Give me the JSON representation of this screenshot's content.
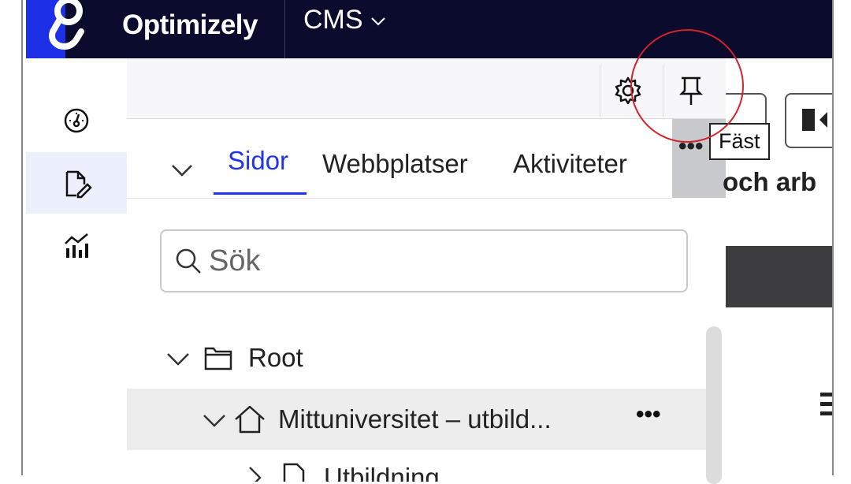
{
  "header": {
    "brand": "Optimizely",
    "product": "CMS"
  },
  "rail": {
    "items": [
      "dashboard-icon",
      "edit-page-icon",
      "analytics-icon"
    ],
    "active_index": 1
  },
  "panel": {
    "tabs": [
      {
        "label": "Sidor",
        "active": true
      },
      {
        "label": "Webbplatser",
        "active": false
      },
      {
        "label": "Aktiviteter",
        "active": false
      }
    ],
    "tabs_more": "•••",
    "search": {
      "placeholder": "Sök",
      "value": ""
    },
    "tree": [
      {
        "label": "Root",
        "icon": "folder-icon",
        "expanded": true
      },
      {
        "label": "Mittuniversitet – utbild...",
        "icon": "home-icon",
        "expanded": true,
        "more": "•••"
      },
      {
        "label": "Utbildning",
        "icon": "page-icon",
        "expanded": false
      }
    ]
  },
  "tooltip": {
    "text": "Fäst"
  },
  "content": {
    "heading_fragment": "och arb"
  },
  "colors": {
    "topbar": "#0b0b2e",
    "logo": "#1e2fe8",
    "accent": "#1f35e6",
    "highlight": "#d2232a"
  }
}
